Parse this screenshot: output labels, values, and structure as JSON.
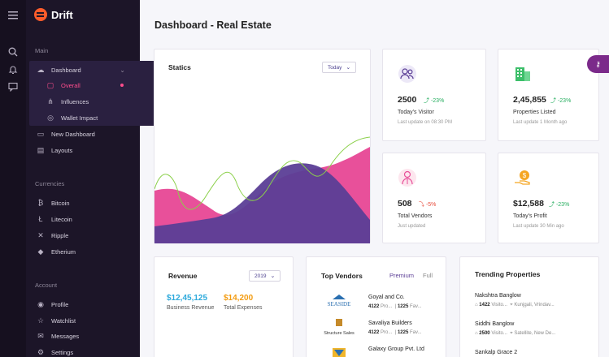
{
  "brand": {
    "name": "Drift"
  },
  "rail": {
    "icons": [
      "menu-icon",
      "search-icon",
      "bell-icon",
      "chat-icon"
    ]
  },
  "sidebar": {
    "sections": {
      "main": "Main",
      "currencies": "Currencies",
      "account": "Account"
    },
    "main_items": [
      {
        "label": "Dashboard",
        "icon": "cloud-icon"
      },
      {
        "label": "Overall",
        "icon": "doc-icon"
      },
      {
        "label": "Influences",
        "icon": "share-icon"
      },
      {
        "label": "Wallet Impact",
        "icon": "target-icon"
      },
      {
        "label": "New Dashboard",
        "icon": "monitor-icon"
      },
      {
        "label": "Layouts",
        "icon": "layout-icon"
      }
    ],
    "currency_items": [
      {
        "label": "Bitcoin",
        "icon": "bitcoin-icon"
      },
      {
        "label": "Litecoin",
        "icon": "litecoin-icon"
      },
      {
        "label": "Ripple",
        "icon": "ripple-icon"
      },
      {
        "label": "Etherium",
        "icon": "ethereum-icon"
      }
    ],
    "account_items": [
      {
        "label": "Profile",
        "icon": "user-icon"
      },
      {
        "label": "Watchlist",
        "icon": "star-icon"
      },
      {
        "label": "Messages",
        "icon": "message-icon"
      },
      {
        "label": "Settings",
        "icon": "gear-icon"
      }
    ]
  },
  "page": {
    "title": "Dashboard - Real Estate"
  },
  "statics": {
    "title": "Statics",
    "filter": "Today"
  },
  "stats": [
    {
      "value": "2500",
      "change": "-23%",
      "label": "Today's Visitor",
      "note": "Last update on 08:30 PM",
      "change_color": "#27ae60"
    },
    {
      "value": "2,45,855",
      "change": "-23%",
      "label": "Properties Listed",
      "note": "Last update 1 Month ago",
      "change_color": "#27ae60"
    },
    {
      "value": "508",
      "change": "-5%",
      "label": "Total Vendors",
      "note": "Just updated",
      "change_color": "#e74c3c"
    },
    {
      "value": "$12,588",
      "change": "-23%",
      "label": "Today's Profit",
      "note": "Last update 30 Min ago",
      "change_color": "#27ae60"
    }
  ],
  "revenue": {
    "title": "Revenue",
    "year": "2019",
    "business_value": "$12,45,125",
    "business_label": "Business Revenue",
    "expense_value": "$14,200",
    "expense_label": "Total Expenses"
  },
  "vendors": {
    "title": "Top Vendors",
    "tab_premium": "Premium",
    "tab_full": "Full",
    "items": [
      {
        "name": "Goyal and Co.",
        "logo": "SEASIDE",
        "count": "4122",
        "count_suffix": "Pro...",
        "sub": "1225",
        "sub_suffix": "Fav..."
      },
      {
        "name": "Savaliya Builders",
        "logo": "Structure Sales",
        "count": "4122",
        "count_suffix": "Pro...",
        "sub": "1225",
        "sub_suffix": "Fav..."
      },
      {
        "name": "Galaxy Group Pvt. Ltd",
        "logo": "",
        "count": "",
        "count_suffix": "",
        "sub": "",
        "sub_suffix": ""
      }
    ]
  },
  "trending": {
    "title": "Trending Properties",
    "items": [
      {
        "name": "Nakshtra Banglow",
        "visits": "1422",
        "visits_suffix": "Visito...",
        "location": "Kunjgali, Vrindav..."
      },
      {
        "name": "Siddhi Banglow",
        "visits": "2500",
        "visits_suffix": "Visito...",
        "location": "Satellite, New De..."
      },
      {
        "name": "Sankalp Grace 2",
        "visits": "",
        "visits_suffix": "",
        "location": ""
      }
    ]
  },
  "colors": {
    "accent": "#ff4d8d",
    "purple": "#5b3e96",
    "pink": "#e8509a",
    "green_line": "#8bd04a"
  }
}
